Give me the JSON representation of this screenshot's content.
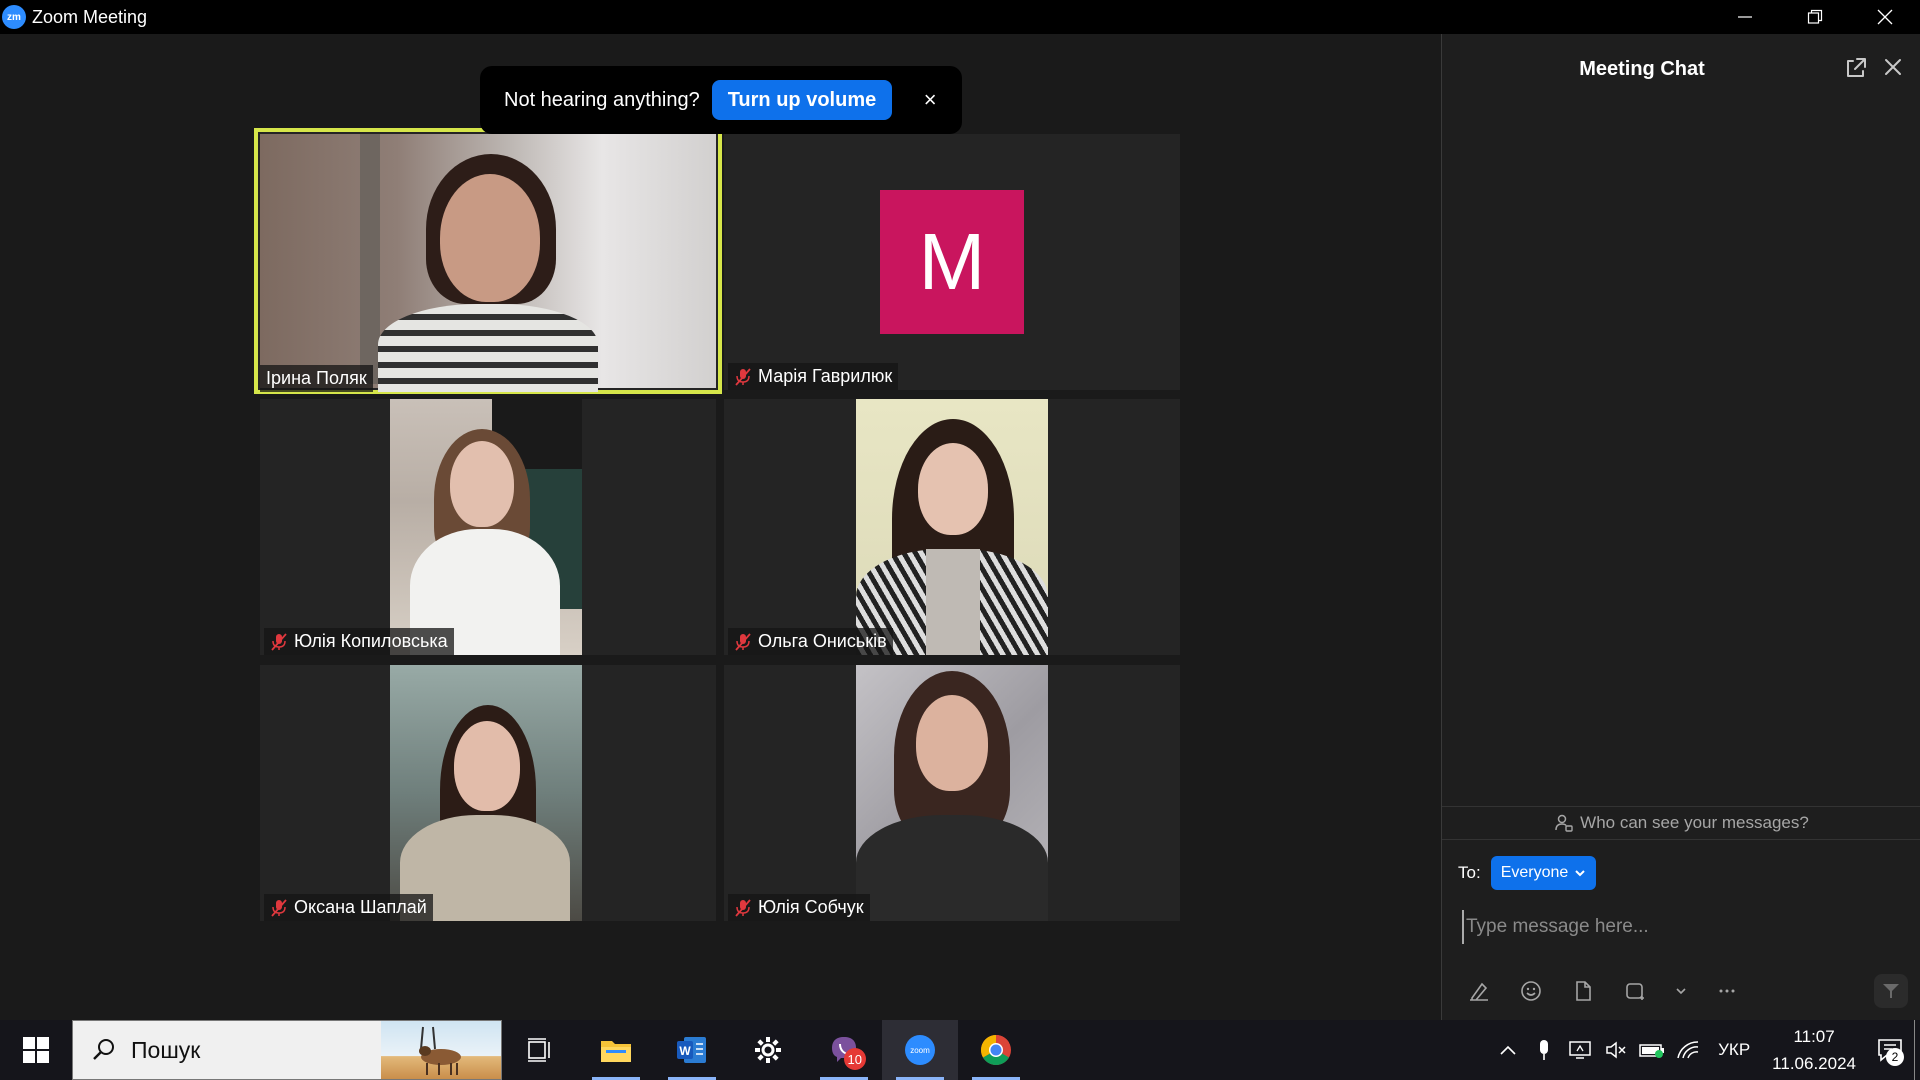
{
  "window": {
    "title": "Zoom Meeting",
    "logo_text": "zm"
  },
  "notice": {
    "text": "Not hearing anything?",
    "button": "Turn up volume",
    "close": "×"
  },
  "participants": [
    {
      "name": "Ірина Поляк",
      "muted": false,
      "speaking": true
    },
    {
      "name": "Марія Гаврилюк",
      "muted": true,
      "avatar_letter": "M",
      "avatar_color": "#c9155e"
    },
    {
      "name": "Юлія Копиловська",
      "muted": true
    },
    {
      "name": "Ольга Ониськів",
      "muted": true
    },
    {
      "name": "Оксана Шаплай",
      "muted": true
    },
    {
      "name": "Юлія Собчук",
      "muted": true
    }
  ],
  "chat": {
    "title": "Meeting Chat",
    "who_can_see": "Who can see your messages?",
    "to_label": "To:",
    "recipient": "Everyone",
    "placeholder": "Type message here..."
  },
  "taskbar": {
    "search_text": "Пошук",
    "viber_badge": "10",
    "language": "УКР",
    "time": "11:07",
    "date": "11.06.2024",
    "notification_count": "2"
  },
  "colors": {
    "accent": "#0e71eb",
    "speaker_outline": "#d6e64a",
    "mute_red": "#e0383e"
  }
}
